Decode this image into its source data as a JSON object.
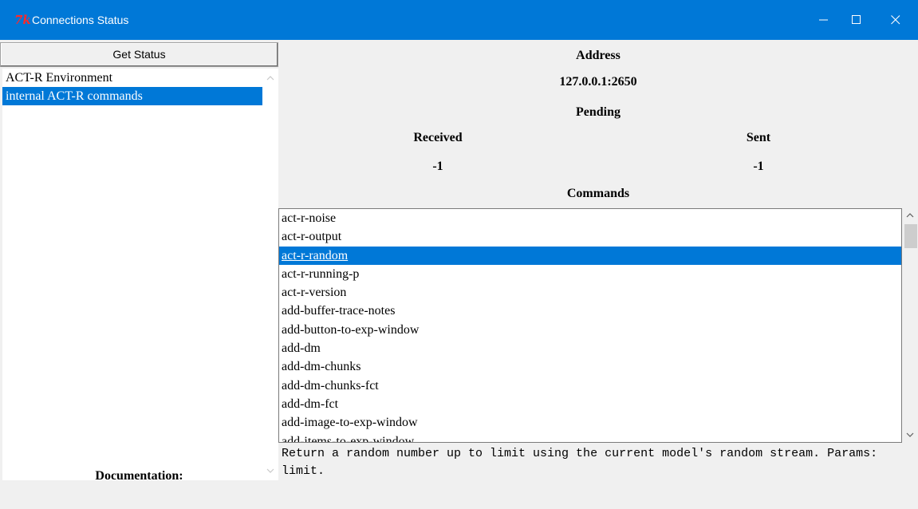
{
  "window": {
    "title": "Connections Status",
    "logo_text": "7k",
    "controls": [
      "minimize",
      "maximize",
      "close"
    ]
  },
  "left_panel": {
    "get_status_label": "Get Status",
    "connections": [
      {
        "label": "ACT-R Environment",
        "selected": false
      },
      {
        "label": "internal ACT-R commands",
        "selected": true
      }
    ]
  },
  "details": {
    "address_heading": "Address",
    "address_value": "127.0.0.1:2650",
    "pending_heading": "Pending",
    "received_heading": "Received",
    "sent_heading": "Sent",
    "received_value": "-1",
    "sent_value": "-1",
    "commands_heading": "Commands",
    "commands": [
      "act-r-noise",
      "act-r-output",
      "act-r-random",
      "act-r-running-p",
      "act-r-version",
      "add-buffer-trace-notes",
      "add-button-to-exp-window",
      "add-dm",
      "add-dm-chunks",
      "add-dm-chunks-fct",
      "add-dm-fct",
      "add-image-to-exp-window",
      "add-items-to-exp-window"
    ],
    "selected_command": "act-r-random"
  },
  "documentation": {
    "label": "Documentation:",
    "text": "Return a random number up to limit using the current model's random stream. Params: limit."
  },
  "colors": {
    "titlebar": "#0078d7",
    "selection": "#0078d7",
    "background": "#f0f0f0"
  }
}
